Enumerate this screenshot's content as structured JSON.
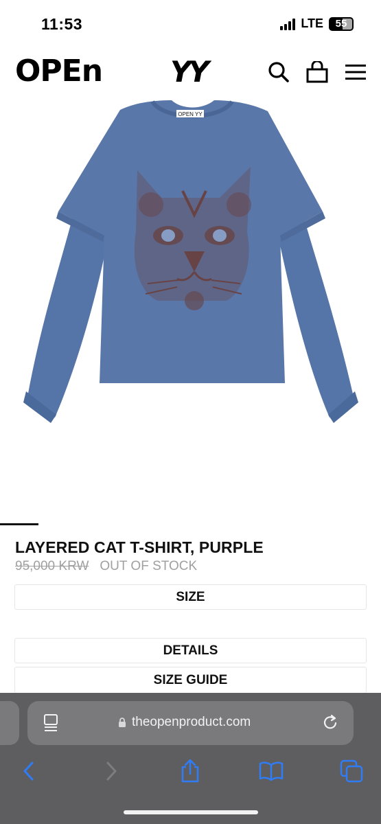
{
  "status_bar": {
    "time": "11:53",
    "network": "LTE",
    "battery": "55"
  },
  "header": {
    "logo_left": "OPEn",
    "logo_right": "YY",
    "icons": [
      "search-icon",
      "bag-icon",
      "menu-icon"
    ]
  },
  "product": {
    "image_label": "OPEN YY",
    "title": "LAYERED CAT T-SHIRT, PURPLE",
    "price": "95,000 KRW",
    "stock_status": "OUT OF STOCK",
    "size_label": "SIZE",
    "details_label": "DETAILS",
    "size_guide_label": "SIZE GUIDE",
    "shirt_color": "#5a77aa",
    "print_color": "#6b3b35"
  },
  "browser": {
    "url": "theopenproduct.com"
  }
}
